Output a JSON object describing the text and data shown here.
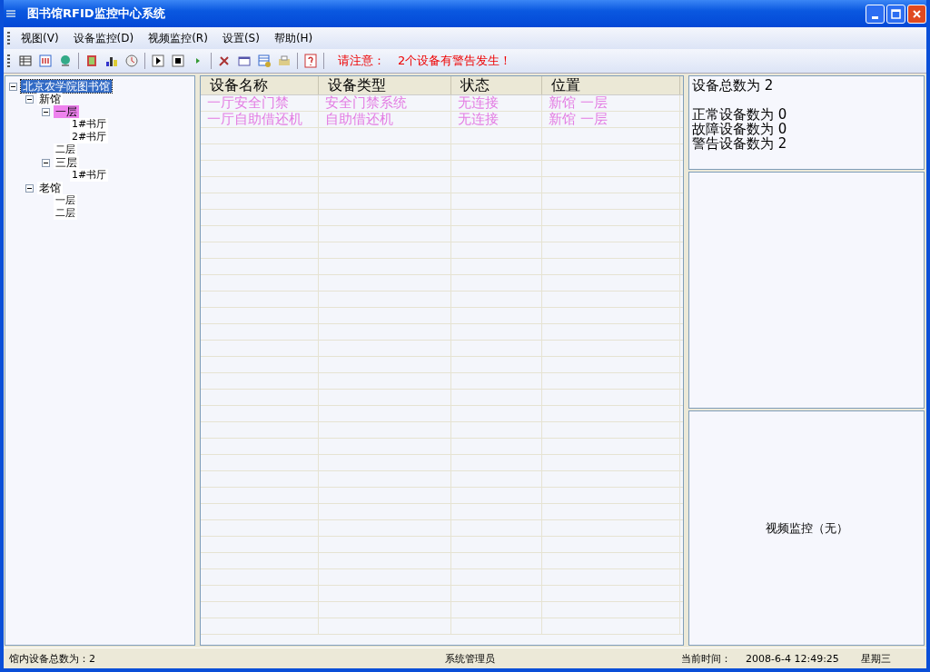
{
  "window": {
    "title": "图书馆RFID监控中心系统"
  },
  "menu": [
    {
      "label": "视图(V)"
    },
    {
      "label": "设备监控(D)"
    },
    {
      "label": "视频监控(R)"
    },
    {
      "label": "设置(S)"
    },
    {
      "label": "帮助(H)"
    }
  ],
  "alert": {
    "label": "请注意：",
    "message": "2个设备有警告发生！"
  },
  "tree": [
    {
      "label": "北京农学院图书馆",
      "selected": true,
      "warning": false,
      "expanded": true,
      "children": [
        {
          "label": "新馆",
          "selected": false,
          "warning": false,
          "expanded": true,
          "children": [
            {
              "label": "一层",
              "selected": false,
              "warning": true,
              "expanded": true,
              "children": [
                {
                  "label": "1#书厅",
                  "selected": false,
                  "warning": false
                },
                {
                  "label": "2#书厅",
                  "selected": false,
                  "warning": false
                }
              ]
            },
            {
              "label": "二层",
              "selected": false,
              "warning": false
            },
            {
              "label": "三层",
              "selected": false,
              "warning": false,
              "expanded": true,
              "children": [
                {
                  "label": "1#书厅",
                  "selected": false,
                  "warning": false
                }
              ]
            }
          ]
        },
        {
          "label": "老馆",
          "selected": false,
          "warning": false,
          "expanded": true,
          "children": [
            {
              "label": "一层",
              "selected": false,
              "warning": false
            },
            {
              "label": "二层",
              "selected": false,
              "warning": false
            }
          ]
        }
      ]
    }
  ],
  "table": {
    "columns": [
      "设备名称",
      "设备类型",
      "状态",
      "位置"
    ],
    "rows": [
      {
        "warning": true,
        "cells": [
          "一厅安全门禁",
          "安全门禁系统",
          "无连接",
          "新馆  一层"
        ]
      },
      {
        "warning": true,
        "cells": [
          "一厅自助借还机",
          "自助借还机",
          "无连接",
          "新馆  一层"
        ]
      }
    ]
  },
  "summary": {
    "total": "设备总数为 2",
    "lines": [
      "正常设备数为 0",
      "故障设备数为 0",
      "警告设备数为 2"
    ]
  },
  "video": {
    "label": "视频监控（无）"
  },
  "status_bar": {
    "device_count": "馆内设备总数为：2",
    "user": "系统管理员",
    "time_label": "当前时间：",
    "time": "2008-6-4 12:49:25",
    "weekday": "星期三"
  }
}
